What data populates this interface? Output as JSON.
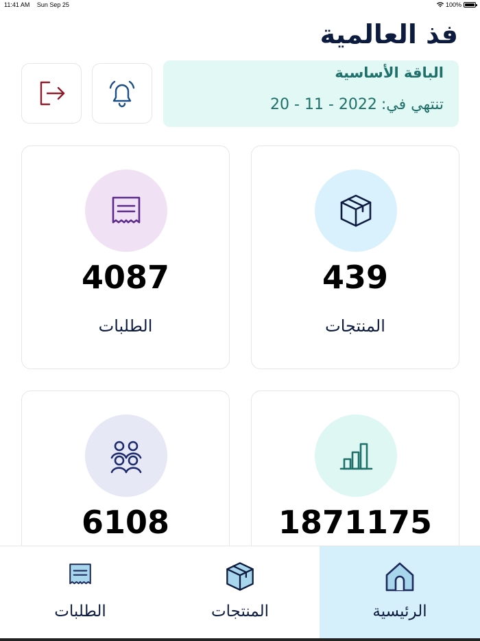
{
  "status_bar": {
    "time": "11:41 AM",
    "date": "Sun Sep 25",
    "battery": "100%"
  },
  "header": {
    "title": "فذ العالمية"
  },
  "plan": {
    "name": "الباقة الأساسية",
    "expiry_label": "تنتهي في:",
    "expiry_date": "20 - 11 - 2022"
  },
  "actions": {
    "notifications_icon": "bell-icon",
    "logout_icon": "logout-icon"
  },
  "stats": {
    "products": {
      "value": "439",
      "label": "المنتجات",
      "icon": "box-icon",
      "color": "#d9f1fc"
    },
    "orders": {
      "value": "4087",
      "label": "الطلبات",
      "icon": "receipt-icon",
      "color": "#f1e1f4"
    },
    "sales": {
      "value": "1871175",
      "icon": "bar-chart-icon",
      "color": "#dff7f3"
    },
    "customers": {
      "value": "6108",
      "icon": "users-icon",
      "color": "#e7e8f5"
    }
  },
  "tabs": {
    "home": {
      "label": "الرئيسية",
      "icon": "home-icon",
      "active": true
    },
    "products": {
      "label": "المنتجات",
      "icon": "box-icon"
    },
    "orders": {
      "label": "الطلبات",
      "icon": "receipt-icon"
    }
  },
  "colors": {
    "accent": "#1f6f6a",
    "primary": "#0d1b3e",
    "active_tab": "#d6f0fb",
    "logout": "#8b1a2b"
  }
}
